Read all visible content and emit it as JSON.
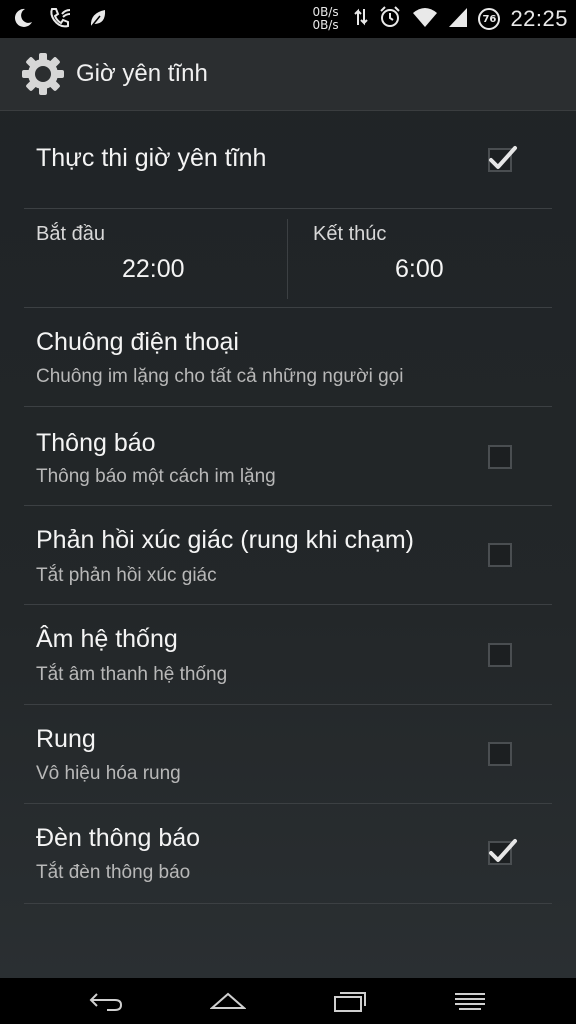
{
  "status_bar": {
    "icons_left": [
      "moon-icon",
      "phone-wifi-icon",
      "leaf-icon"
    ],
    "speed_up": "0B/s",
    "speed_down": "0B/s",
    "battery": "76",
    "time": "22:25"
  },
  "header": {
    "title": "Giờ yên tĩnh",
    "icon": "gear-icon"
  },
  "enable": {
    "label": "Thực thi giờ yên tĩnh",
    "checked": true
  },
  "schedule": {
    "start_label": "Bắt đầu",
    "start_value": "22:00",
    "end_label": "Kết thúc",
    "end_value": "6:00"
  },
  "settings": [
    {
      "title": "Chuông điện thoại",
      "subtitle": "Chuông im lặng cho tất cả những người gọi",
      "has_checkbox": false,
      "checked": false
    },
    {
      "title": "Thông báo",
      "subtitle": "Thông báo một cách im lặng",
      "has_checkbox": true,
      "checked": false
    },
    {
      "title": "Phản hồi xúc giác (rung khi chạm)",
      "subtitle": "Tắt phản hồi xúc giác",
      "has_checkbox": true,
      "checked": false
    },
    {
      "title": "Âm hệ thống",
      "subtitle": "Tắt âm thanh hệ thống",
      "has_checkbox": true,
      "checked": false
    },
    {
      "title": "Rung",
      "subtitle": "Vô hiệu hóa rung",
      "has_checkbox": true,
      "checked": false
    },
    {
      "title": "Đèn thông báo",
      "subtitle": "Tắt đèn thông báo",
      "has_checkbox": true,
      "checked": true
    }
  ],
  "nav_bar": [
    "back-icon",
    "home-icon",
    "recent-apps-icon",
    "menu-icon"
  ]
}
